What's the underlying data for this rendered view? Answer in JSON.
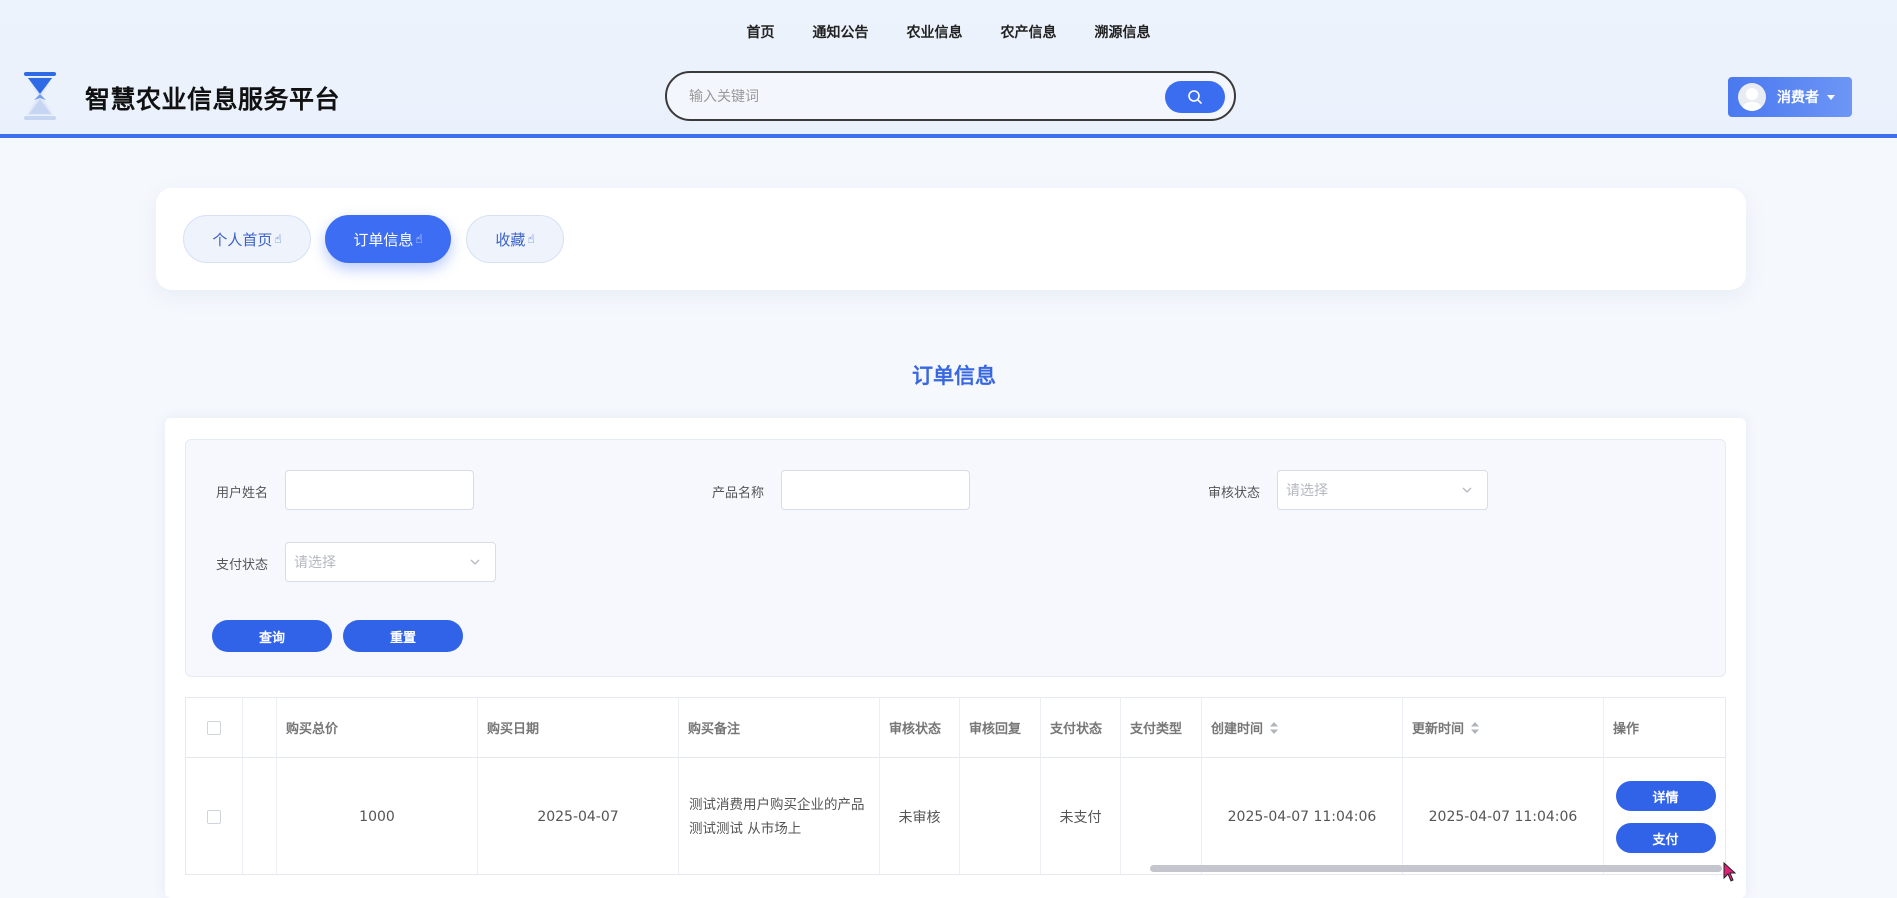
{
  "nav": {
    "items": [
      "首页",
      "通知公告",
      "农业信息",
      "农产信息",
      "溯源信息"
    ]
  },
  "site": {
    "title": "智慧农业信息服务平台"
  },
  "search": {
    "placeholder": "输入关键词",
    "value": ""
  },
  "user": {
    "name": "消费者"
  },
  "tabs": [
    {
      "label": "个人首页"
    },
    {
      "label": "订单信息"
    },
    {
      "label": "收藏"
    }
  ],
  "page": {
    "title": "订单信息"
  },
  "filters": {
    "user_name_label": "用户姓名",
    "product_name_label": "产品名称",
    "audit_status_label": "审核状态",
    "audit_status_placeholder": "请选择",
    "pay_status_label": "支付状态",
    "pay_status_placeholder": "请选择",
    "query_button": "查询",
    "reset_button": "重置"
  },
  "table": {
    "headers": {
      "total_price": "购买总价",
      "purchase_date": "购买日期",
      "remark": "购买备注",
      "audit_status": "审核状态",
      "audit_reply": "审核回复",
      "pay_status": "支付状态",
      "pay_type": "支付类型",
      "created_at": "创建时间",
      "updated_at": "更新时间",
      "actions": "操作"
    },
    "rows": [
      {
        "total_price": "1000",
        "purchase_date": "2025-04-07",
        "remark": "测试消费用户购买企业的产品 测试测试 从市场上",
        "audit_status": "未审核",
        "audit_reply": "",
        "pay_status": "未支付",
        "pay_type": "",
        "created_at": "2025-04-07 11:04:06",
        "updated_at": "2025-04-07 11:04:06",
        "detail_button": "详情",
        "pay_button": "支付"
      }
    ]
  },
  "colors": {
    "accent": "#3d6df2",
    "button": "#3163e9",
    "title": "#3867e0",
    "header_border": "#3e6ff0"
  }
}
